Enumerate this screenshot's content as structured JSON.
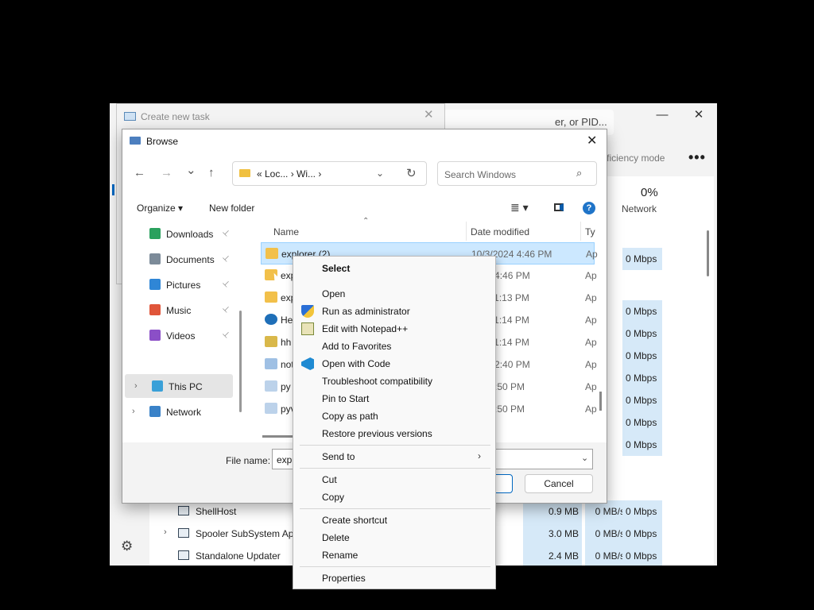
{
  "task_manager": {
    "search_fragment": "er, or PID...",
    "efficiency_mode": "fficiency mode",
    "more": "•••",
    "network_pct": "0%",
    "network_label": "Network",
    "network_cells": [
      "0 Mbps",
      "0 Mbps",
      "0 Mbps",
      "0 Mbps",
      "0 Mbps",
      "0 Mbps",
      "0 Mbps",
      "0 Mbps",
      "0 Mbps",
      "0 Mbps",
      "0 Mbps"
    ],
    "rows": [
      {
        "name": "ShellHost",
        "memory": "0.9 MB",
        "disk": "0 MB/s",
        "network": "0 Mbps",
        "expandable": false
      },
      {
        "name": "Spooler SubSystem App",
        "memory": "3.0 MB",
        "disk": "0 MB/s",
        "network": "0 Mbps",
        "expandable": true
      },
      {
        "name": "Standalone Updater",
        "memory": "2.4 MB",
        "disk": "0 MB/s",
        "network": "0 Mbps",
        "expandable": false
      }
    ],
    "window_controls": {
      "minimize": "—",
      "maximize": "☐",
      "close": "✕"
    }
  },
  "create_task": {
    "title": "Create new task",
    "close": "✕"
  },
  "browse": {
    "title": "Browse",
    "close": "✕",
    "nav": {
      "back": "←",
      "forward": "→",
      "recent": "⌄",
      "up": "↑"
    },
    "address": "« Loc...  ›  Wi...  ›",
    "address_drop": "⌄",
    "refresh": "↻",
    "search_placeholder": "Search Windows",
    "search_icon": "⌕",
    "organize": "Organize ▾",
    "new_folder": "New folder",
    "view": "≣ ▾",
    "help": "?",
    "nav_items": [
      {
        "label": "Downloads",
        "icon": "download-icon",
        "color": "#2aa15e",
        "pin": "📌"
      },
      {
        "label": "Documents",
        "icon": "documents-icon",
        "color": "#7c8b99",
        "pin": "📌"
      },
      {
        "label": "Pictures",
        "icon": "pictures-icon",
        "color": "#2f86d6",
        "pin": "📌"
      },
      {
        "label": "Music",
        "icon": "music-icon",
        "color": "#e0553a",
        "pin": "📌"
      },
      {
        "label": "Videos",
        "icon": "videos-icon",
        "color": "#8b4fc7",
        "pin": "📌"
      },
      {
        "label": "This PC",
        "icon": "this-pc-icon",
        "color": "#3aa0d8",
        "chev": "›"
      },
      {
        "label": "Network",
        "icon": "network-icon",
        "color": "#3a82c8",
        "chev": "›"
      }
    ],
    "columns": {
      "name": "Name",
      "date": "Date modified",
      "type": "Ty"
    },
    "sort_arrow": "⌃",
    "files": [
      {
        "name": "explorer (2)",
        "date": "10/3/2024 4:46 PM",
        "type": "Ap",
        "icon": "explorer-icon"
      },
      {
        "name": "exp",
        "date": "2024 4:46 PM",
        "type": "Ap",
        "icon": "explorer-icon"
      },
      {
        "name": "exp",
        "date": "024 11:13 PM",
        "type": "Ap",
        "icon": "explorer-icon"
      },
      {
        "name": "He",
        "date": "024 11:14 PM",
        "type": "Ap",
        "icon": "help-icon"
      },
      {
        "name": "hh",
        "date": "024 11:14 PM",
        "type": "Ap",
        "icon": "hh-icon"
      },
      {
        "name": "not",
        "date": "024 12:40 PM",
        "type": "Ap",
        "icon": "notepad-icon"
      },
      {
        "name": "py",
        "date": "024 2:50 PM",
        "type": "Ap",
        "icon": "python-icon"
      },
      {
        "name": "pyv",
        "date": "024 2:50 PM",
        "type": "Ap",
        "icon": "python-icon"
      }
    ],
    "file_name_label": "File name:",
    "file_name_value": "explor",
    "file_name_drop": "⌄",
    "cancel": "Cancel"
  },
  "context_menu": {
    "header": "Select",
    "groups": [
      [
        {
          "label": "Open",
          "icon": ""
        },
        {
          "label": "Run as administrator",
          "icon": "shield-icon"
        },
        {
          "label": "Edit with Notepad++",
          "icon": "notepadpp-icon"
        },
        {
          "label": "Add to Favorites",
          "icon": ""
        },
        {
          "label": "Open with Code",
          "icon": "vscode-icon"
        },
        {
          "label": "Troubleshoot compatibility",
          "icon": ""
        },
        {
          "label": "Pin to Start",
          "icon": ""
        },
        {
          "label": "Copy as path",
          "icon": ""
        },
        {
          "label": "Restore previous versions",
          "icon": ""
        }
      ],
      [
        {
          "label": "Send to",
          "icon": "",
          "submenu": "›"
        }
      ],
      [
        {
          "label": "Cut",
          "icon": ""
        },
        {
          "label": "Copy",
          "icon": ""
        }
      ],
      [
        {
          "label": "Create shortcut",
          "icon": ""
        },
        {
          "label": "Delete",
          "icon": ""
        },
        {
          "label": "Rename",
          "icon": ""
        }
      ],
      [
        {
          "label": "Properties",
          "icon": ""
        }
      ]
    ]
  },
  "colors": {
    "accent": "#0067c0",
    "selection": "#cce8ff",
    "heat": "#d6e9f8"
  }
}
